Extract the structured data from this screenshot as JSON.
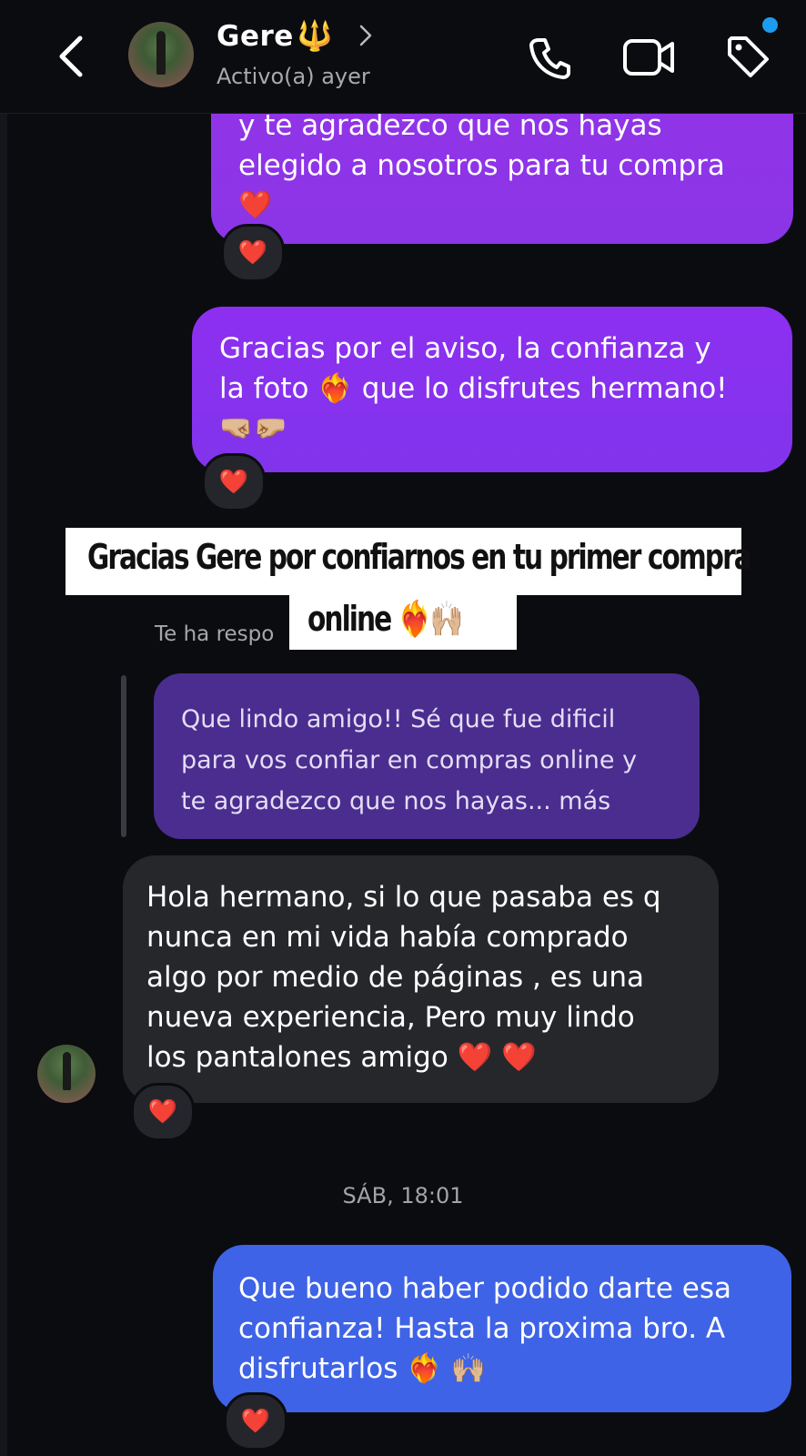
{
  "header": {
    "name": "Gere",
    "name_emoji": "🔱",
    "status": "Activo(a) ayer",
    "icons": [
      "back-chevron-icon",
      "phone-icon",
      "video-icon",
      "tag-icon"
    ],
    "notification_dot_color": "#1d9bf0"
  },
  "messages": {
    "m1": {
      "lines": [
        "y te agradezco que nos hayas",
        "elegido a nosotros para tu compra"
      ],
      "emoji": "❤️",
      "reaction": "❤️"
    },
    "m2": {
      "lines": [
        "Gracias por el aviso, la confianza y",
        "la foto ❤️‍🔥 que lo disfrutes hermano!",
        "🤜🏼🤛🏼"
      ],
      "reaction": "❤️"
    },
    "replied_label": "Te ha respo",
    "m3": {
      "lines": [
        "Que lindo amigo!! Sé que fue dificil",
        "para vos confiar en compras online y",
        "te agradezco que nos hayas... más"
      ]
    },
    "m4": {
      "lines": [
        "Hola hermano, si lo que pasaba es q",
        "nunca en mi vida había comprado",
        "algo por medio de páginas , es una",
        "nueva experiencia, Pero muy lindo",
        "los pantalones amigo ❤️ ❤️"
      ],
      "reaction": "❤️"
    },
    "timestamp": "SÁB, 18:01",
    "m5": {
      "lines": [
        "Que bueno haber podido darte esa",
        "confianza! Hasta la proxima bro. A",
        "disfrutarlos ❤️‍🔥 🙌🏼"
      ],
      "reaction": "❤️"
    }
  },
  "caption": {
    "line1": "Gracias Gere por confiarnos en tu primer compra",
    "line2": "online ❤️‍🔥🙌🏼"
  },
  "colors": {
    "background": "#0b0c10",
    "sent_purple": "#8d2ff0",
    "reply_purple": "#4a2d8f",
    "received_gray": "#26272b",
    "sent_blue": "#3e63e6",
    "heart": "#ee2a2a"
  }
}
